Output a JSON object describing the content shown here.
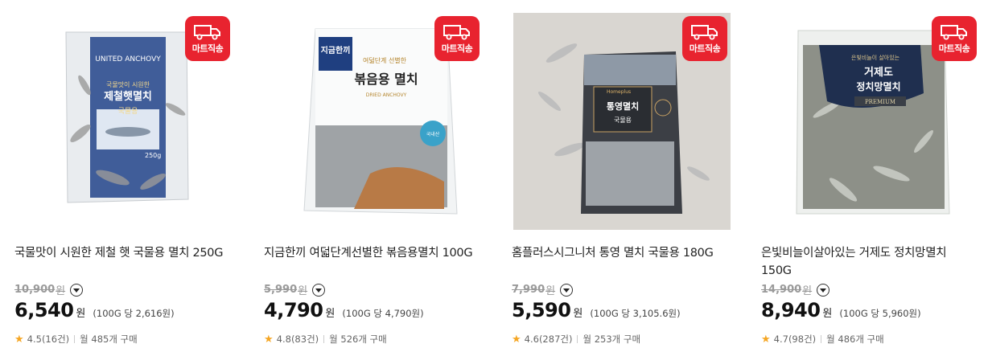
{
  "badge_label": "마트직송",
  "colors": {
    "badge": "#e8232f",
    "star": "#f5a623"
  },
  "products": [
    {
      "title": "국물맛이 시원한 제철 햇 국물용 멸치 250G",
      "original_price": "10,900",
      "original_unit": "원",
      "price": "6,540",
      "price_unit": "원",
      "unit_price": "(100G 당 2,616원)",
      "rating": "4.5(16건)",
      "monthly_sales": "월 485개 구매",
      "package_text": {
        "line1": "UNITED ANCHOVY",
        "line2": "국물맛이 시원한",
        "line3": "제철햇멸치",
        "line4": "국물용",
        "weight": "250g"
      }
    },
    {
      "title": "지금한끼 여덟단계선별한 볶음용멸치 100G",
      "original_price": "5,990",
      "original_unit": "원",
      "price": "4,790",
      "price_unit": "원",
      "unit_price": "(100G 당 4,790원)",
      "rating": "4.8(83건)",
      "monthly_sales": "월 526개 구매",
      "package_text": {
        "brand": "지금한끼",
        "line1": "여덟단계 선별한",
        "line2": "볶음용 멸치",
        "line3": "DRIED ANCHOVY",
        "tag": "국내산"
      }
    },
    {
      "title": "홈플러스시그니처 통영 멸치 국물용 180G",
      "original_price": "7,990",
      "original_unit": "원",
      "price": "5,590",
      "price_unit": "원",
      "unit_price": "(100G 당 3,105.6원)",
      "rating": "4.6(287건)",
      "monthly_sales": "월 253개 구매",
      "package_text": {
        "brand": "Homeplus",
        "line1": "통영멸치",
        "line2": "국물용"
      }
    },
    {
      "title": "은빛비늘이살아있는 거제도 정치망멸치 150G",
      "original_price": "14,900",
      "original_unit": "원",
      "price": "8,940",
      "price_unit": "원",
      "unit_price": "(100G 당 5,960원)",
      "rating": "4.7(98건)",
      "monthly_sales": "월 486개 구매",
      "package_text": {
        "line1": "은빛비늘이 살아있는",
        "line2": "거제도",
        "line3": "정치망멸치",
        "line4": "PREMIUM"
      }
    }
  ]
}
